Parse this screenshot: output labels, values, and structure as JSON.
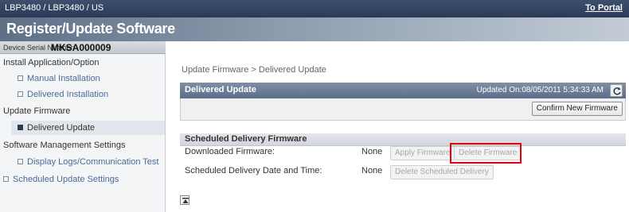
{
  "header": {
    "model": "LBP3480 / LBP3480 / US",
    "portal_link": "To Portal",
    "title": "Register/Update Software"
  },
  "device": {
    "serial_label": "Device Serial Number:",
    "serial_number": "MKSA000009"
  },
  "sidebar": {
    "items": [
      {
        "label": "Install Application/Option",
        "type": "section"
      },
      {
        "label": "Manual Installation",
        "type": "sub"
      },
      {
        "label": "Delivered Installation",
        "type": "sub"
      },
      {
        "label": "Update Firmware",
        "type": "section"
      },
      {
        "label": "Delivered Update",
        "type": "sub",
        "active": true
      },
      {
        "label": "Software Management Settings",
        "type": "section"
      },
      {
        "label": "Display Logs/Communication Test",
        "type": "sub"
      },
      {
        "label": "Scheduled Update Settings",
        "type": "sub"
      }
    ]
  },
  "main": {
    "breadcrumb": "Update Firmware > Delivered Update",
    "panel_title": "Delivered Update",
    "updated_on": "Updated On:08/05/2011 5:34:33 AM",
    "confirm_button": "Confirm New Firmware",
    "scheduled_title": "Scheduled Delivery Firmware",
    "rows": [
      {
        "label": "Downloaded Firmware:",
        "value": "None"
      },
      {
        "label": "Scheduled Delivery Date and Time:",
        "value": "None"
      }
    ],
    "apply_button": "Apply Firmware",
    "delete_button": "Delete Firmware",
    "delete_scheduled_button": "Delete Scheduled Delivery"
  },
  "icons": {
    "refresh": "refresh-icon",
    "scroll_top": "scroll-top-icon"
  },
  "colors": {
    "header_bg": "#2c3a55",
    "highlight": "#e3000f"
  }
}
